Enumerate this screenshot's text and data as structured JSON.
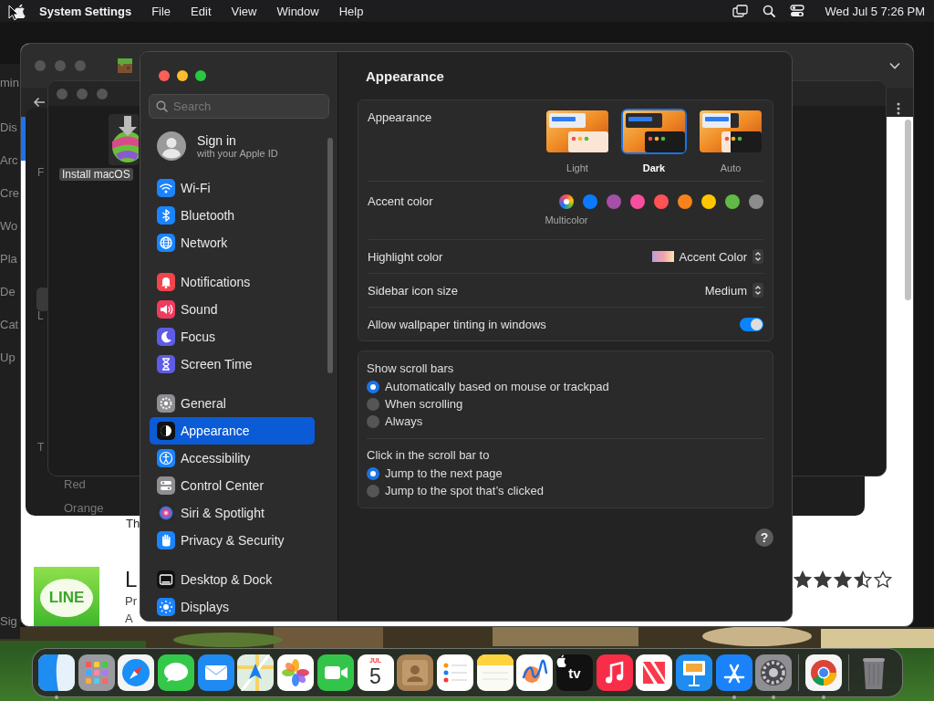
{
  "menu_bar": {
    "app_name": "System Settings",
    "menus": [
      "File",
      "Edit",
      "View",
      "Window",
      "Help"
    ],
    "clock": "Wed Jul 5 7:26 PM"
  },
  "back_windows": {
    "left_window": {
      "title": "min",
      "sidebar_items": [
        "Dis",
        "Arc",
        "Cre",
        "Wo",
        "Pla",
        "De",
        "Cat",
        "Up"
      ],
      "footer": "Sig"
    },
    "store_window": {
      "heading": "Th",
      "app": {
        "icon_text": "LINE",
        "name": "L",
        "subtitle": "Pr",
        "description": "A",
        "stars": 3.5
      }
    },
    "finder_window": {
      "sidebar_letters": [
        "F",
        "L",
        "T"
      ],
      "tags": [
        "Red",
        "Orange"
      ]
    },
    "installer_window": {
      "file_label": "Install macOS"
    }
  },
  "settings": {
    "sidebar": {
      "search": {
        "placeholder": "Search"
      },
      "account": {
        "title": "Sign in",
        "subtitle": "with your Apple ID"
      },
      "groups": [
        {
          "items": [
            {
              "kind": "wifi",
              "label": "Wi-Fi",
              "selected": false
            },
            {
              "kind": "bluetooth",
              "label": "Bluetooth",
              "selected": false
            },
            {
              "kind": "network",
              "label": "Network",
              "selected": false
            }
          ]
        },
        {
          "items": [
            {
              "kind": "notifications",
              "label": "Notifications",
              "selected": false
            },
            {
              "kind": "sound",
              "label": "Sound",
              "selected": false
            },
            {
              "kind": "focus",
              "label": "Focus",
              "selected": false
            },
            {
              "kind": "screen_time",
              "label": "Screen Time",
              "selected": false
            }
          ]
        },
        {
          "items": [
            {
              "kind": "general",
              "label": "General",
              "selected": false
            },
            {
              "kind": "appearance",
              "label": "Appearance",
              "selected": true
            },
            {
              "kind": "accessibility",
              "label": "Accessibility",
              "selected": false
            },
            {
              "kind": "control_center",
              "label": "Control Center",
              "selected": false
            },
            {
              "kind": "siri",
              "label": "Siri & Spotlight",
              "selected": false
            },
            {
              "kind": "privacy",
              "label": "Privacy & Security",
              "selected": false
            }
          ]
        },
        {
          "items": [
            {
              "kind": "desktop_dock",
              "label": "Desktop & Dock",
              "selected": false
            },
            {
              "kind": "displays",
              "label": "Displays",
              "selected": false
            }
          ]
        }
      ]
    },
    "pane": {
      "title": "Appearance",
      "appearance": {
        "label": "Appearance",
        "options": [
          {
            "kind": "light",
            "label": "Light",
            "selected": false
          },
          {
            "kind": "dark",
            "label": "Dark",
            "selected": true
          },
          {
            "kind": "auto",
            "label": "Auto",
            "selected": false
          }
        ]
      },
      "accent": {
        "label": "Accent color",
        "colors": [
          {
            "kind": "multicolor",
            "name": "Multicolor",
            "selected": true
          },
          {
            "kind": "solid",
            "color": "#0a7aff",
            "selected": false
          },
          {
            "kind": "solid",
            "color": "#a550a7",
            "selected": false
          },
          {
            "kind": "solid",
            "color": "#f74f9e",
            "selected": false
          },
          {
            "kind": "solid",
            "color": "#ff5257",
            "selected": false
          },
          {
            "kind": "solid",
            "color": "#f7821b",
            "selected": false
          },
          {
            "kind": "solid",
            "color": "#ffc600",
            "selected": false
          },
          {
            "kind": "solid",
            "color": "#62ba46",
            "selected": false
          },
          {
            "kind": "solid",
            "color": "#8c8c8c",
            "selected": false
          }
        ]
      },
      "highlight": {
        "label": "Highlight color",
        "value": "Accent Color"
      },
      "icon_size": {
        "label": "Sidebar icon size",
        "value": "Medium"
      },
      "tinting": {
        "label": "Allow wallpaper tinting in windows",
        "on": true
      },
      "scroll_bars": [
        {
          "title": "Show scroll bars",
          "options": [
            {
              "label": "Automatically based on mouse or trackpad",
              "selected": true
            },
            {
              "label": "When scrolling",
              "selected": false
            },
            {
              "label": "Always",
              "selected": false
            }
          ]
        },
        {
          "title": "Click in the scroll bar to",
          "options": [
            {
              "label": "Jump to the next page",
              "selected": true
            },
            {
              "label": "Jump to the spot that’s clicked",
              "selected": false
            }
          ]
        }
      ],
      "help_button": "?"
    }
  },
  "dock": {
    "sections": [
      {
        "items": [
          {
            "kind": "finder",
            "running": true
          },
          {
            "kind": "launchpad",
            "running": false
          },
          {
            "kind": "safari",
            "running": false
          },
          {
            "kind": "messages",
            "running": false
          },
          {
            "kind": "mail",
            "running": false
          },
          {
            "kind": "maps",
            "running": false
          },
          {
            "kind": "photos",
            "running": false
          },
          {
            "kind": "facetime",
            "running": false
          },
          {
            "kind": "calendar",
            "month": "JUL",
            "day": "5",
            "running": false
          },
          {
            "kind": "contacts",
            "running": false
          },
          {
            "kind": "reminders",
            "running": false
          },
          {
            "kind": "notes",
            "running": false
          },
          {
            "kind": "freeform",
            "running": false
          },
          {
            "kind": "tv",
            "label": "tv",
            "running": false
          },
          {
            "kind": "music",
            "running": false
          },
          {
            "kind": "news",
            "running": false
          },
          {
            "kind": "keynote",
            "running": false
          },
          {
            "kind": "appstore",
            "running": true
          },
          {
            "kind": "settings",
            "running": true
          }
        ]
      },
      {
        "items": [
          {
            "kind": "chrome",
            "running": true
          }
        ]
      },
      {
        "items": [
          {
            "kind": "trash",
            "running": false
          }
        ]
      }
    ]
  }
}
